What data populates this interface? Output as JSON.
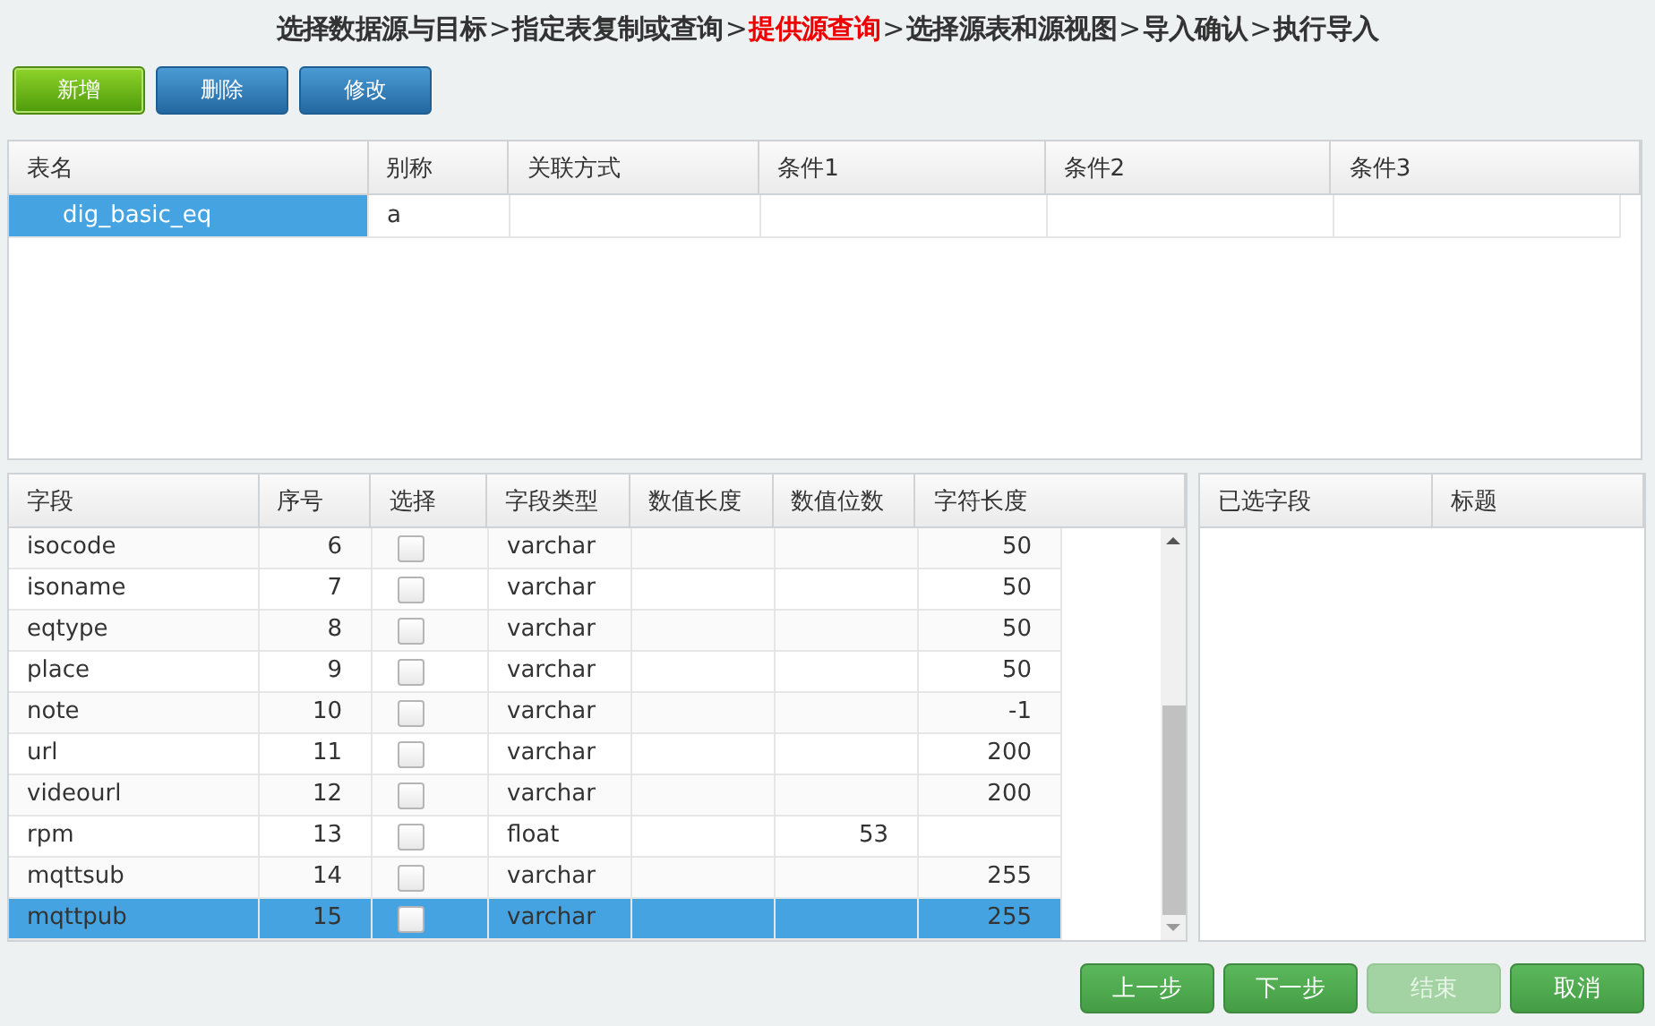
{
  "wizard_steps": [
    {
      "kind": "step",
      "label": "选择数据源与目标",
      "current": false
    },
    {
      "kind": "separator",
      "label": ">",
      "current": false
    },
    {
      "kind": "step",
      "label": "指定表复制或查询",
      "current": false
    },
    {
      "kind": "separator",
      "label": ">",
      "current": false
    },
    {
      "kind": "step",
      "label": "提供源查询",
      "current": true
    },
    {
      "kind": "separator",
      "label": ">",
      "current": false
    },
    {
      "kind": "step",
      "label": "选择源表和源视图",
      "current": false
    },
    {
      "kind": "separator",
      "label": ">",
      "current": false
    },
    {
      "kind": "step",
      "label": "导入确认",
      "current": false
    },
    {
      "kind": "separator",
      "label": ">",
      "current": false
    },
    {
      "kind": "step",
      "label": "执行导入",
      "current": false
    }
  ],
  "toolbar": [
    {
      "label": "新增",
      "kind": "primary"
    },
    {
      "label": "删除",
      "kind": "normal"
    },
    {
      "label": "修改",
      "kind": "normal"
    }
  ],
  "tables_grid": {
    "columns": [
      "表名",
      "别称",
      "关联方式",
      "条件1",
      "条件2",
      "条件3"
    ],
    "rows": [
      {
        "cells": [
          "dig_basic_eq",
          "a",
          "",
          "",
          "",
          ""
        ],
        "selected": true
      }
    ]
  },
  "fields_grid": {
    "columns": [
      "字段",
      "序号",
      "选择",
      "字段类型",
      "数值长度",
      "数值位数",
      "字符长度"
    ],
    "rows": [
      {
        "name": "isocode",
        "index": "6",
        "checked": false,
        "type": "varchar",
        "num_length": "",
        "num_digits": "",
        "char_length": "50",
        "selected": false
      },
      {
        "name": "isoname",
        "index": "7",
        "checked": false,
        "type": "varchar",
        "num_length": "",
        "num_digits": "",
        "char_length": "50",
        "selected": false
      },
      {
        "name": "eqtype",
        "index": "8",
        "checked": false,
        "type": "varchar",
        "num_length": "",
        "num_digits": "",
        "char_length": "50",
        "selected": false
      },
      {
        "name": "place",
        "index": "9",
        "checked": false,
        "type": "varchar",
        "num_length": "",
        "num_digits": "",
        "char_length": "50",
        "selected": false
      },
      {
        "name": "note",
        "index": "10",
        "checked": false,
        "type": "varchar",
        "num_length": "",
        "num_digits": "",
        "char_length": "-1",
        "selected": false
      },
      {
        "name": "url",
        "index": "11",
        "checked": false,
        "type": "varchar",
        "num_length": "",
        "num_digits": "",
        "char_length": "200",
        "selected": false
      },
      {
        "name": "videourl",
        "index": "12",
        "checked": false,
        "type": "varchar",
        "num_length": "",
        "num_digits": "",
        "char_length": "200",
        "selected": false
      },
      {
        "name": "rpm",
        "index": "13",
        "checked": false,
        "type": "float",
        "num_length": "",
        "num_digits": "53",
        "char_length": "",
        "selected": false
      },
      {
        "name": "mqttsub",
        "index": "14",
        "checked": false,
        "type": "varchar",
        "num_length": "",
        "num_digits": "",
        "char_length": "255",
        "selected": false
      },
      {
        "name": "mqttpub",
        "index": "15",
        "checked": false,
        "type": "varchar",
        "num_length": "",
        "num_digits": "",
        "char_length": "255",
        "selected": true
      }
    ]
  },
  "selected_grid": {
    "columns": [
      "已选字段",
      "标题"
    ]
  },
  "footer_buttons": [
    {
      "label": "上一步",
      "disabled": false
    },
    {
      "label": "下一步",
      "disabled": false
    },
    {
      "label": "结束",
      "disabled": true
    },
    {
      "label": "取消",
      "disabled": false
    }
  ]
}
